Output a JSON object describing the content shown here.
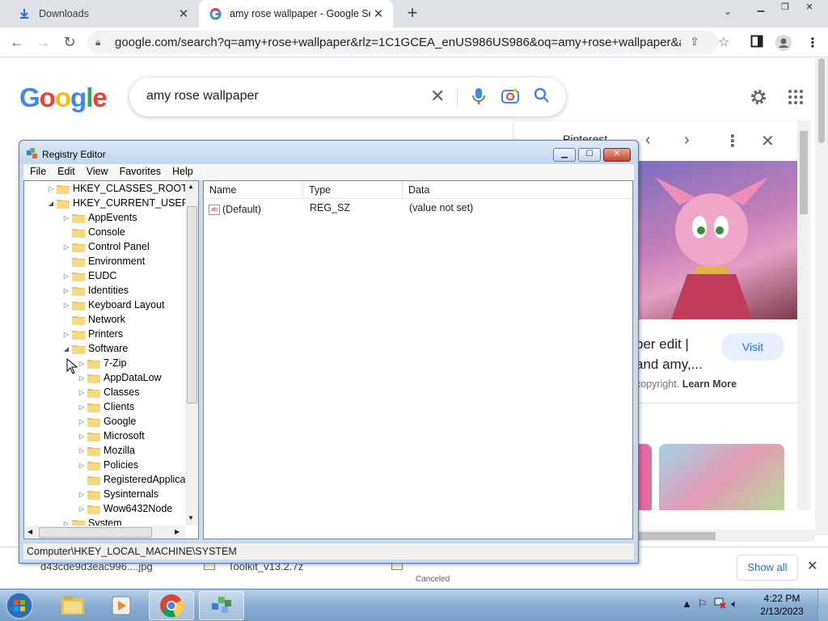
{
  "browser": {
    "tabs": [
      {
        "title": "Downloads"
      },
      {
        "title": "amy rose wallpaper - Google Sea"
      }
    ],
    "new_tab": "+",
    "url": "google.com/search?q=amy+rose+wallpaper&rlz=1C1GCEA_enUS986US986&oq=amy+rose+wallpaper&aqs=ch..."
  },
  "google": {
    "logo": "Google",
    "query": "amy rose wallpaper"
  },
  "preview": {
    "source": "Pinterest",
    "title_line1": "per edit |",
    "title_line2": "and amy,...",
    "visit_label": "Visit",
    "copyright": "copyright.",
    "learn_more": "Learn More"
  },
  "downloads": {
    "items": [
      {
        "name": "d43cde9d3eac996....jpg",
        "status": ""
      },
      {
        "name": "Toolkit_v13.2.7z",
        "status": ""
      },
      {
        "name": "",
        "status": "Canceled"
      }
    ],
    "show_all": "Show all"
  },
  "regedit": {
    "title": "Registry Editor",
    "menu": [
      "File",
      "Edit",
      "View",
      "Favorites",
      "Help"
    ],
    "tree": [
      {
        "label": "HKEY_CLASSES_ROOT",
        "level": 0,
        "expander": "▷"
      },
      {
        "label": "HKEY_CURRENT_USER",
        "level": 0,
        "expander": "◢"
      },
      {
        "label": "AppEvents",
        "level": 1,
        "expander": "▷"
      },
      {
        "label": "Console",
        "level": 1,
        "expander": ""
      },
      {
        "label": "Control Panel",
        "level": 1,
        "expander": "▷"
      },
      {
        "label": "Environment",
        "level": 1,
        "expander": ""
      },
      {
        "label": "EUDC",
        "level": 1,
        "expander": "▷"
      },
      {
        "label": "Identities",
        "level": 1,
        "expander": "▷"
      },
      {
        "label": "Keyboard Layout",
        "level": 1,
        "expander": "▷"
      },
      {
        "label": "Network",
        "level": 1,
        "expander": ""
      },
      {
        "label": "Printers",
        "level": 1,
        "expander": "▷"
      },
      {
        "label": "Software",
        "level": 1,
        "expander": "◢"
      },
      {
        "label": "7-Zip",
        "level": 2,
        "expander": "▷"
      },
      {
        "label": "AppDataLow",
        "level": 2,
        "expander": "▷"
      },
      {
        "label": "Classes",
        "level": 2,
        "expander": "▷"
      },
      {
        "label": "Clients",
        "level": 2,
        "expander": "▷"
      },
      {
        "label": "Google",
        "level": 2,
        "expander": "▷"
      },
      {
        "label": "Microsoft",
        "level": 2,
        "expander": "▷"
      },
      {
        "label": "Mozilla",
        "level": 2,
        "expander": "▷"
      },
      {
        "label": "Policies",
        "level": 2,
        "expander": "▷"
      },
      {
        "label": "RegisteredApplica",
        "level": 2,
        "expander": ""
      },
      {
        "label": "Sysinternals",
        "level": 2,
        "expander": "▷"
      },
      {
        "label": "Wow6432Node",
        "level": 2,
        "expander": "▷"
      },
      {
        "label": "System",
        "level": 1,
        "expander": "▷"
      }
    ],
    "columns": [
      "Name",
      "Type",
      "Data"
    ],
    "rows": [
      {
        "name": "(Default)",
        "type": "REG_SZ",
        "data": "(value not set)"
      }
    ],
    "status_path": "Computer\\HKEY_LOCAL_MACHINE\\SYSTEM"
  },
  "taskbar": {
    "time": "4:22 PM",
    "date": "2/13/2023"
  },
  "colors": {
    "google_blue": "#4285F4",
    "google_red": "#EA4335",
    "google_yellow": "#FBBC05",
    "google_green": "#34A853",
    "link_blue": "#1a73e8"
  }
}
